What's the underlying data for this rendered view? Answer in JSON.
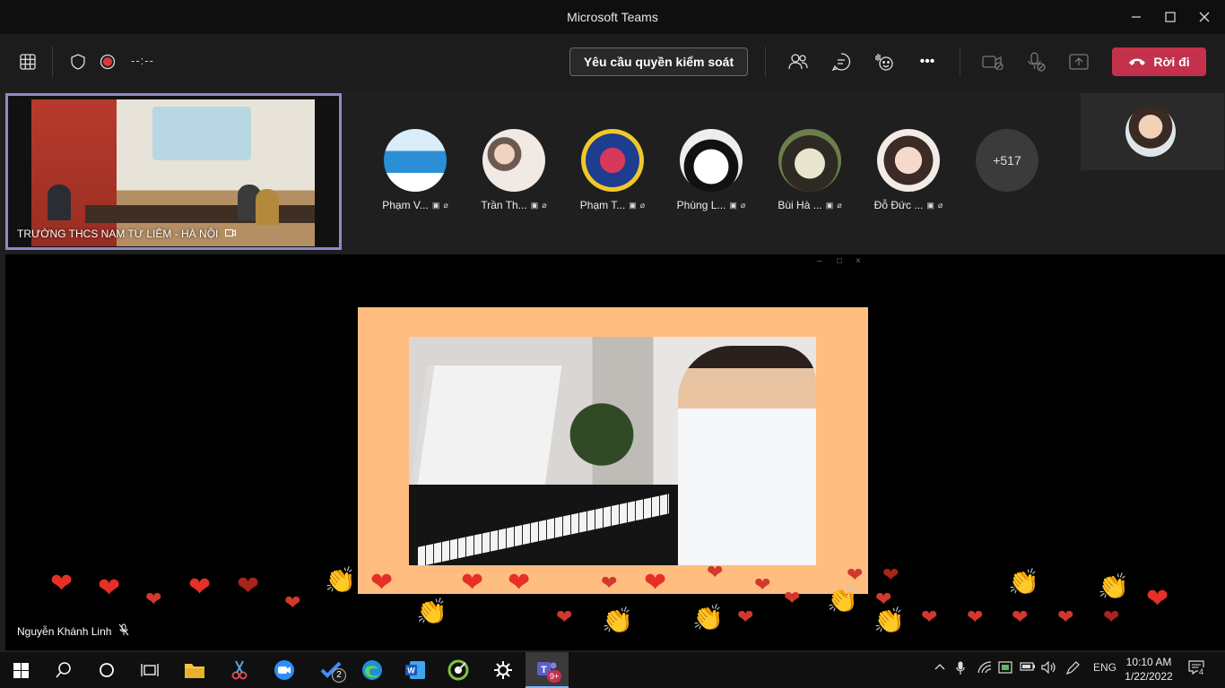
{
  "window": {
    "title": "Microsoft Teams",
    "minimize": "—",
    "maximize": "☐",
    "close": "✕"
  },
  "toolbar": {
    "timer": "--:--",
    "request_control_label": "Yêu cầu quyền kiểm soát",
    "leave_label": "Rời đi",
    "more_label": "•••"
  },
  "pinned": {
    "name": "TRƯỜNG THCS NAM TỪ LIÊM - HÀ NỘI"
  },
  "participants": [
    {
      "name": "Phạm V..."
    },
    {
      "name": "Trần Th..."
    },
    {
      "name": "Phạm T..."
    },
    {
      "name": "Phùng L..."
    },
    {
      "name": "Bùi Hà ..."
    },
    {
      "name": "Đỗ Đức ..."
    }
  ],
  "overflow_count": "+517",
  "share": {
    "speaker": "Nguyễn Khánh Linh",
    "window_controls": [
      "–",
      "□",
      "×"
    ]
  },
  "taskbar": {
    "edge_label": "2",
    "teams_badge": "9+",
    "language": "ENG",
    "time": "10:10 AM",
    "date": "1/22/2022",
    "notifications": "4"
  },
  "colors": {
    "accent": "#8b8cc7",
    "leave": "#c4314b",
    "frame": "#ffbd7f"
  }
}
